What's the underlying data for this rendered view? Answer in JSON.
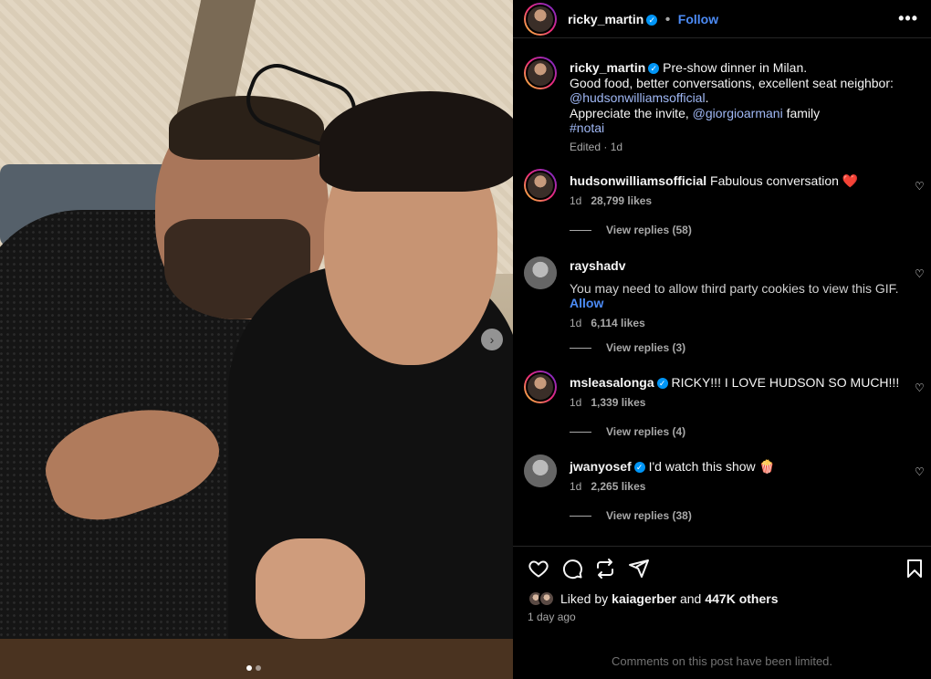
{
  "post": {
    "author": "ricky_martin",
    "follow_label": "Follow",
    "more_label": "•••",
    "caption": {
      "line1": "Pre-show dinner in Milan.",
      "line2": "Good food, better conversations, excellent seat neighbor:",
      "mention1": "@hudsonwilliamsofficial",
      "period": ".",
      "line4_prefix": "Appreciate the invite,",
      "mention2": "@giorgioarmani",
      "line4_suffix": "family",
      "hashtag": "#notai",
      "meta": "Edited · 1d"
    }
  },
  "comments": [
    {
      "user": "hudsonwilliamsofficial",
      "verified": false,
      "text": "Fabulous conversation ❤️",
      "time": "1d",
      "likes": "28,799 likes",
      "replies": "View replies (58)"
    },
    {
      "user": "rayshadv",
      "verified": false,
      "text": "You may need to allow third party cookies to view this GIF.",
      "allow": "Allow",
      "time": "1d",
      "likes": "6,114 likes",
      "replies": "View replies (3)"
    },
    {
      "user": "msleasalonga",
      "verified": true,
      "text": "RICKY!!! I LOVE HUDSON SO MUCH!!!",
      "time": "1d",
      "likes": "1,339 likes",
      "replies": "View replies (4)"
    },
    {
      "user": "jwanyosef",
      "verified": true,
      "text": "I'd watch this show 🍿",
      "time": "1d",
      "likes": "2,265 likes",
      "replies": "View replies (38)"
    }
  ],
  "footer": {
    "liked_prefix": "Liked by",
    "liked_user": "kaiagerber",
    "liked_and": "and",
    "liked_others": "447K others",
    "date": "1 day ago",
    "limited": "Comments on this post have been limited."
  },
  "colors": {
    "link": "#4c8bf5",
    "verified": "#0095f6",
    "background": "#000000"
  }
}
